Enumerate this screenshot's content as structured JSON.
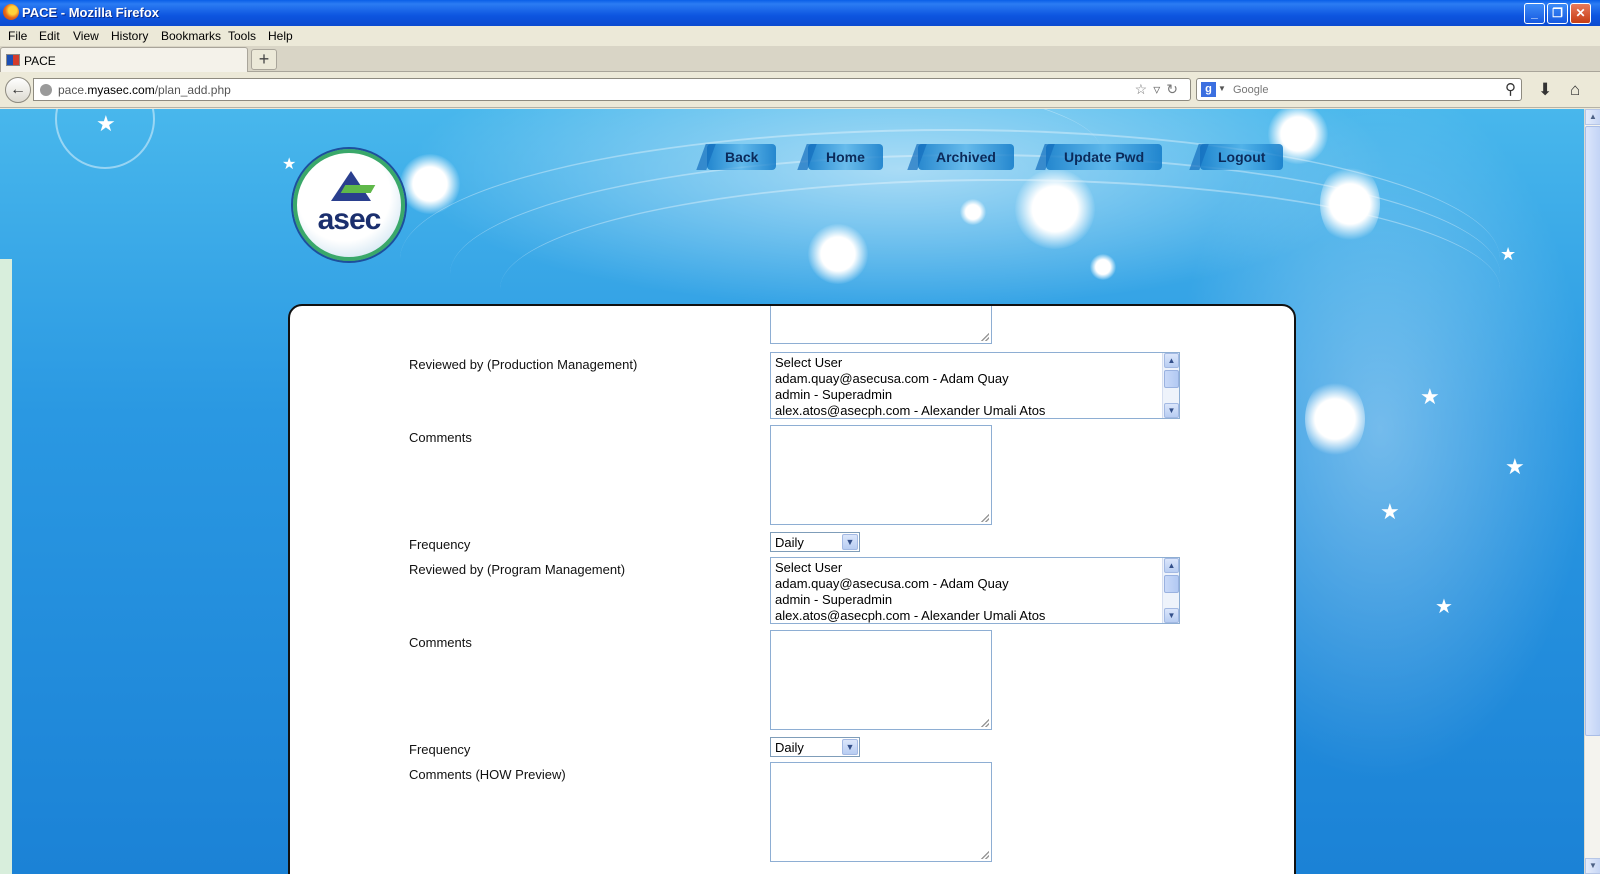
{
  "window": {
    "title": "PACE - Mozilla Firefox",
    "controls": {
      "minimize": "_",
      "restore": "❐",
      "close": "✕"
    }
  },
  "menu": [
    "File",
    "Edit",
    "View",
    "History",
    "Bookmarks",
    "Tools",
    "Help"
  ],
  "tab": {
    "label": "PACE",
    "new_tab": "+"
  },
  "address": {
    "url_prefix": "pace.",
    "url_domain": "myasec.com",
    "url_path": "/plan_add.php"
  },
  "search": {
    "engine_icon": "g",
    "placeholder": "Google"
  },
  "site": {
    "logo_text": "asec",
    "nav": [
      "Back",
      "Home",
      "Archived",
      "Update Pwd",
      "Logout"
    ]
  },
  "form": {
    "prod_review_label": "Reviewed by (Production Management)",
    "prod_users": [
      "Select User",
      "adam.quay@asecusa.com - Adam Quay",
      "admin - Superadmin",
      "alex.atos@asecph.com - Alexander Umali Atos"
    ],
    "comments_label_1": "Comments",
    "frequency_label_1": "Frequency",
    "frequency_value_1": "Daily",
    "prog_review_label": "Reviewed by (Program Management)",
    "prog_users": [
      "Select User",
      "adam.quay@asecusa.com - Adam Quay",
      "admin - Superadmin",
      "alex.atos@asecph.com - Alexander Umali Atos"
    ],
    "comments_label_2": "Comments",
    "frequency_label_2": "Frequency",
    "frequency_value_2": "Daily",
    "how_preview_label": "Comments (HOW Preview)"
  }
}
